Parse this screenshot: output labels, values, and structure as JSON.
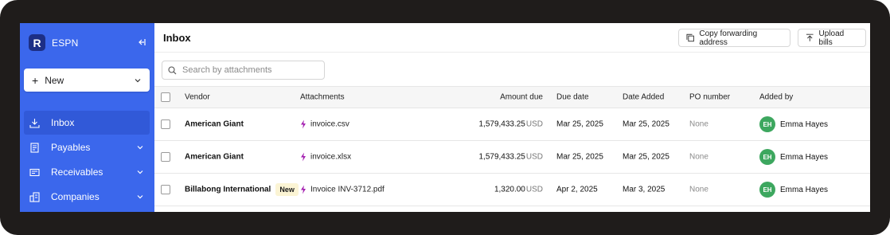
{
  "colors": {
    "sidebar": "#3b67ec",
    "sidebar_active": "#3159d8",
    "logo_bg": "#1d2f86",
    "avatar_bg": "#3da75f",
    "attachment_icon": "#a21caf",
    "badge_bg": "#fbf4d4"
  },
  "sidebar": {
    "logo_letter": "R",
    "org_name": "ESPN",
    "new_label": "New",
    "items": [
      {
        "label": "Inbox",
        "icon": "inbox-icon",
        "active": true
      },
      {
        "label": "Payables",
        "icon": "payables-icon"
      },
      {
        "label": "Receivables",
        "icon": "receivables-icon"
      },
      {
        "label": "Companies",
        "icon": "companies-icon"
      }
    ]
  },
  "header": {
    "title": "Inbox",
    "copy_label": "Copy forwarding address",
    "upload_label": "Upload bills"
  },
  "search": {
    "placeholder": "Search by attachments"
  },
  "table": {
    "columns": [
      "Vendor",
      "Attachments",
      "Amount due",
      "Due date",
      "Date Added",
      "PO number",
      "Added by"
    ],
    "rows": [
      {
        "vendor": "American Giant",
        "badge": "",
        "attachment": "invoice.csv",
        "amount": "1,579,433.25",
        "currency": "USD",
        "due": "Mar 25, 2025",
        "added": "Mar 25, 2025",
        "po": "None",
        "initials": "EH",
        "user": "Emma Hayes"
      },
      {
        "vendor": "American Giant",
        "badge": "",
        "attachment": "invoice.xlsx",
        "amount": "1,579,433.25",
        "currency": "USD",
        "due": "Mar 25, 2025",
        "added": "Mar 25, 2025",
        "po": "None",
        "initials": "EH",
        "user": "Emma Hayes"
      },
      {
        "vendor": "Billabong International",
        "badge": "New",
        "attachment": "Invoice INV-3712.pdf",
        "amount": "1,320.00",
        "currency": "USD",
        "due": "Apr 2, 2025",
        "added": "Mar 3, 2025",
        "po": "None",
        "initials": "EH",
        "user": "Emma Hayes"
      }
    ]
  }
}
